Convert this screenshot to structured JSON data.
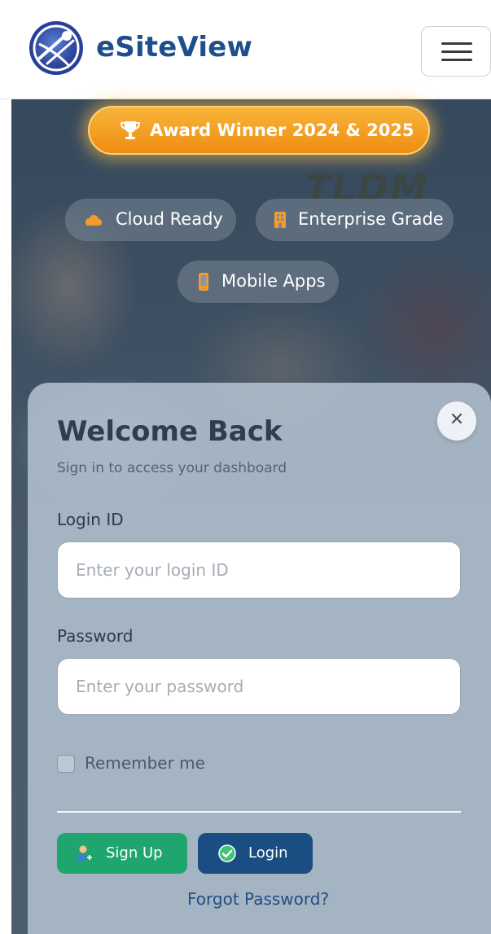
{
  "header": {
    "brand": "eSiteView",
    "logo_icon": "esiteview-globe-logo",
    "menu_icon": "hamburger-menu-icon"
  },
  "hero": {
    "background_text": "TLDM",
    "award": {
      "icon": "trophy-icon",
      "label": "Award Winner 2024 & 2025"
    },
    "features": [
      {
        "icon": "cloud-icon",
        "label": "Cloud Ready",
        "icon_color": "#f59b2b"
      },
      {
        "icon": "building-icon",
        "label": "Enterprise Grade",
        "icon_color": "#f59b2b"
      },
      {
        "icon": "mobile-icon",
        "label": "Mobile Apps",
        "icon_color": "#f59b2b"
      }
    ]
  },
  "login_modal": {
    "title": "Welcome Back",
    "subtitle": "Sign in to access your dashboard",
    "close_icon": "close-icon",
    "login_id": {
      "label": "Login ID",
      "placeholder": "Enter your login ID",
      "value": ""
    },
    "password": {
      "label": "Password",
      "placeholder": "Enter your password",
      "value": ""
    },
    "remember_me": {
      "label": "Remember me",
      "checked": false
    },
    "signup_button": {
      "label": "Sign Up",
      "icon": "user-add-icon"
    },
    "login_button": {
      "label": "Login",
      "icon": "check-circle-icon"
    },
    "forgot_password": "Forgot Password?"
  },
  "colors": {
    "brand": "#1f4e8c",
    "award": "#f0961a",
    "signup": "#1fa66f",
    "login": "#1a4d82"
  }
}
